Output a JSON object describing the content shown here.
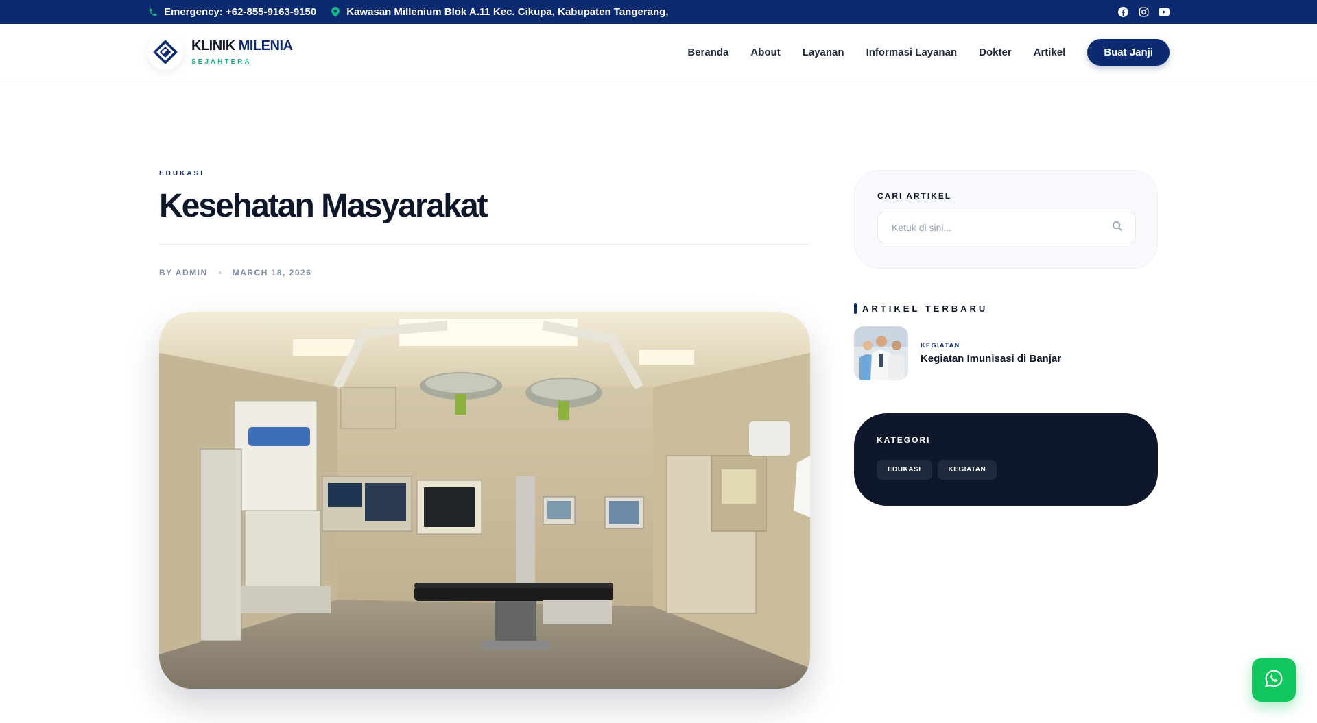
{
  "topbar": {
    "emergency": "Emergency: +62-855-9163-9150",
    "address": "Kawasan Millenium Blok A.11 Kec. Cikupa, Kabupaten Tangerang,",
    "social_icons": [
      "facebook-icon",
      "instagram-icon",
      "youtube-icon"
    ]
  },
  "brand": {
    "name_part1": "KLINIK",
    "name_part2": "MILENIA",
    "tagline": "SEJAHTERA",
    "primary_color": "#0b2a6f",
    "accent_color": "#10b981"
  },
  "nav": {
    "items": [
      "Beranda",
      "About",
      "Layanan",
      "Informasi Layanan",
      "Dokter",
      "Artikel"
    ],
    "cta": "Buat Janji"
  },
  "article": {
    "category": "EDUKASI",
    "title": "Kesehatan Masyarakat",
    "author": "BY ADMIN",
    "date": "MARCH 18, 2026"
  },
  "sidebar": {
    "search": {
      "heading": "CARI ARTIKEL",
      "placeholder": "Ketuk di sini..."
    },
    "recent": {
      "heading": "ARTIKEL TERBARU",
      "items": [
        {
          "category": "KEGIATAN",
          "title": "Kegiatan Imunisasi di Banjar"
        }
      ]
    },
    "categories": {
      "heading": "KATEGORI",
      "items": [
        "EDUKASI",
        "KEGIATAN"
      ]
    }
  }
}
